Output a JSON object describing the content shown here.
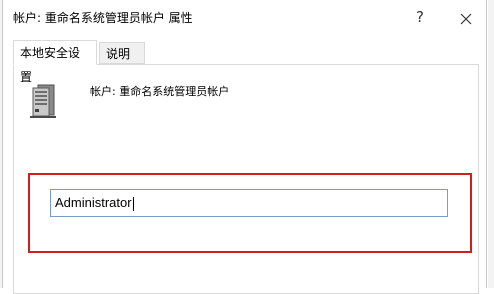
{
  "window": {
    "title": "帐户: 重命名系统管理员帐户 属性",
    "help_label": "?",
    "close_label": "✕"
  },
  "tabs": [
    {
      "label": "本地安全设置",
      "active": true
    },
    {
      "label": "说明",
      "active": false
    }
  ],
  "policy": {
    "icon": "server-icon",
    "label": "帐户: 重命名系统管理员帐户"
  },
  "account_name_input": {
    "value": "Administrator"
  },
  "colors": {
    "highlight": "#d11f1f",
    "input_border": "#7a9cc6"
  }
}
